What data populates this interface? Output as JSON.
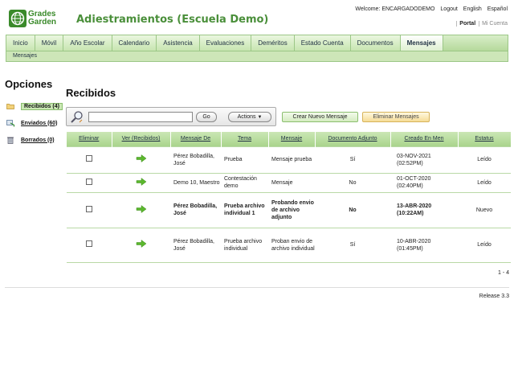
{
  "brand": {
    "logo_line1": "Grades",
    "logo_line2": "Garden",
    "app_title": "Adiestramientos (Escuela Demo)"
  },
  "header": {
    "welcome": "Welcome: ENCARGADODEMO",
    "logout": "Logout",
    "english": "English",
    "espanol": "Español",
    "portal": "Portal",
    "mi_cuenta": "Mi Cuenta"
  },
  "nav": {
    "tabs": [
      "Inicio",
      "Móvil",
      "Año Escolar",
      "Calendario",
      "Asistencia",
      "Evaluaciones",
      "Deméritos",
      "Estado Cuenta",
      "Documentos",
      "Mensajes"
    ],
    "active": "Mensajes",
    "subnav": "Mensajes"
  },
  "sidebar": {
    "title": "Opciones",
    "items": [
      {
        "label": "Recibidos (4)",
        "icon": "folder-icon"
      },
      {
        "label": "Enviados (60)",
        "icon": "sent-mail-icon"
      },
      {
        "label": "Borrados (0)",
        "icon": "trash-icon"
      }
    ]
  },
  "main": {
    "title": "Recibidos",
    "search_placeholder": "",
    "go_label": "Go",
    "actions_label": "Actions",
    "new_message_label": "Crear Nuevo Mensaje",
    "delete_messages_label": "Eliminar Mensajes",
    "columns": [
      "Eliminar",
      "Ver (Recibidos)",
      "Mensaje De",
      "Tema",
      "Mensaje",
      "Documento Adjunto",
      "Creado En Men",
      "Estatus"
    ],
    "rows": [
      {
        "from": "Pérez Bobadilla, José",
        "subject": "Prueba",
        "message": "Mensaje prueba",
        "attachment": "Sí",
        "created": "03-NOV-2021 (02:52PM)",
        "status": "Leído",
        "unread": false
      },
      {
        "from": "Demo 10, Maestro",
        "subject": "Contestación demo",
        "message": "Mensaje",
        "attachment": "No",
        "created": "01-OCT-2020 (02:40PM)",
        "status": "Leído",
        "unread": false
      },
      {
        "from": "Pérez Bobadilla, José",
        "subject": "Prueba archivo individual 1",
        "message": "Probando envio de archivo adjunto",
        "attachment": "No",
        "created": "13-ABR-2020 (10:22AM)",
        "status": "Nuevo",
        "unread": true
      },
      {
        "from": "Pérez Bobadilla, José",
        "subject": "Prueba archivo individual",
        "message": "Proban envio de archivo individual",
        "attachment": "Sí",
        "created": "10-ABR-2020 (01:45PM)",
        "status": "Leído",
        "unread": false
      }
    ],
    "pager": "1 - 4"
  },
  "footer": {
    "release": "Release 3.3"
  },
  "colors": {
    "accent": "#4a8f3a",
    "tab_bg": "#c7e5b0",
    "arrow": "#5cb82e"
  }
}
